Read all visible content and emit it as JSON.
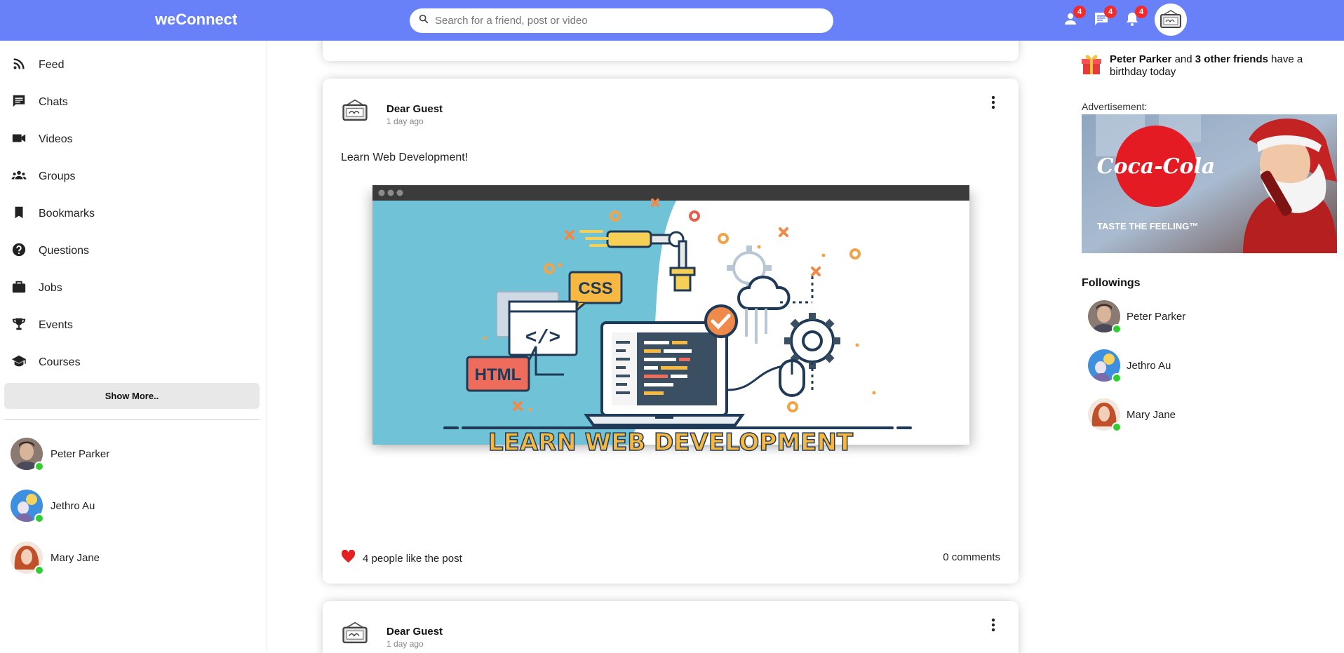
{
  "topbar": {
    "logo": "weConnect",
    "search_placeholder": "Search for a friend, post or video",
    "friend_requests_count": "4",
    "messages_count": "4",
    "notifications_count": "4"
  },
  "sidebar": {
    "items": [
      {
        "label": "Feed",
        "icon": "rss-feed-icon"
      },
      {
        "label": "Chats",
        "icon": "chat-icon"
      },
      {
        "label": "Videos",
        "icon": "video-camera-icon"
      },
      {
        "label": "Groups",
        "icon": "groups-icon"
      },
      {
        "label": "Bookmarks",
        "icon": "bookmark-icon"
      },
      {
        "label": "Questions",
        "icon": "help-circle-icon"
      },
      {
        "label": "Jobs",
        "icon": "briefcase-icon"
      },
      {
        "label": "Events",
        "icon": "trophy-icon"
      },
      {
        "label": "Courses",
        "icon": "school-icon"
      }
    ],
    "show_more": "Show More..",
    "friends": [
      {
        "name": "Peter Parker"
      },
      {
        "name": "Jethro Au"
      },
      {
        "name": "Mary Jane"
      }
    ]
  },
  "feed": {
    "posts": [
      {
        "user": "Dear Guest",
        "date": "1 day ago",
        "text": "Learn Web Development!",
        "image": {
          "css_label": "CSS",
          "html_label": "HTML",
          "banner": "LEARN WEB DEVELOPMENT"
        },
        "likes": "4 people like the post",
        "comments": "0 comments"
      },
      {
        "user": "Dear Guest",
        "date": "1 day ago"
      }
    ]
  },
  "rightbar": {
    "birthday": {
      "name": "Peter Parker",
      "and": " and ",
      "others": "3 other friends",
      "suffix": " have a birthday today"
    },
    "ad_label": "Advertisement:",
    "ad": {
      "brand": "Coca-Cola",
      "tagline": "TASTE THE FEELING™"
    },
    "followings_title": "Followings",
    "followings": [
      {
        "name": "Peter Parker"
      },
      {
        "name": "Jethro Au"
      },
      {
        "name": "Mary Jane"
      }
    ]
  },
  "colors": {
    "topbar": "#6881f8",
    "badge": "#f32b2b",
    "online": "#32cd32",
    "like": "#e52020"
  }
}
